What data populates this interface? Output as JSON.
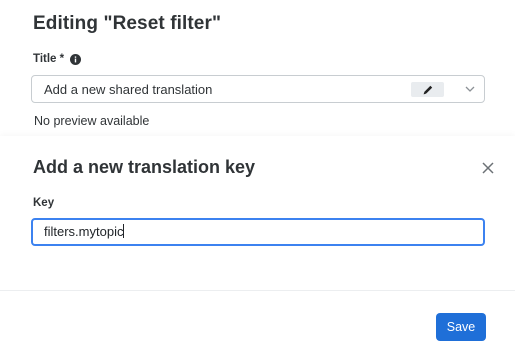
{
  "editor": {
    "title": "Editing \"Reset filter\"",
    "field_label": "Title *",
    "selected_value": "Add a new shared translation",
    "preview_text": "No preview available"
  },
  "modal": {
    "title": "Add a new translation key",
    "key_label": "Key",
    "key_value": "filters.mytopic",
    "save_label": "Save"
  },
  "colors": {
    "primary": "#1f6fd8",
    "focus_border": "#3c82f0"
  },
  "icons": {
    "info": "info-icon",
    "edit": "pencil-icon",
    "dropdown": "chevron-down-icon",
    "close": "close-icon"
  }
}
